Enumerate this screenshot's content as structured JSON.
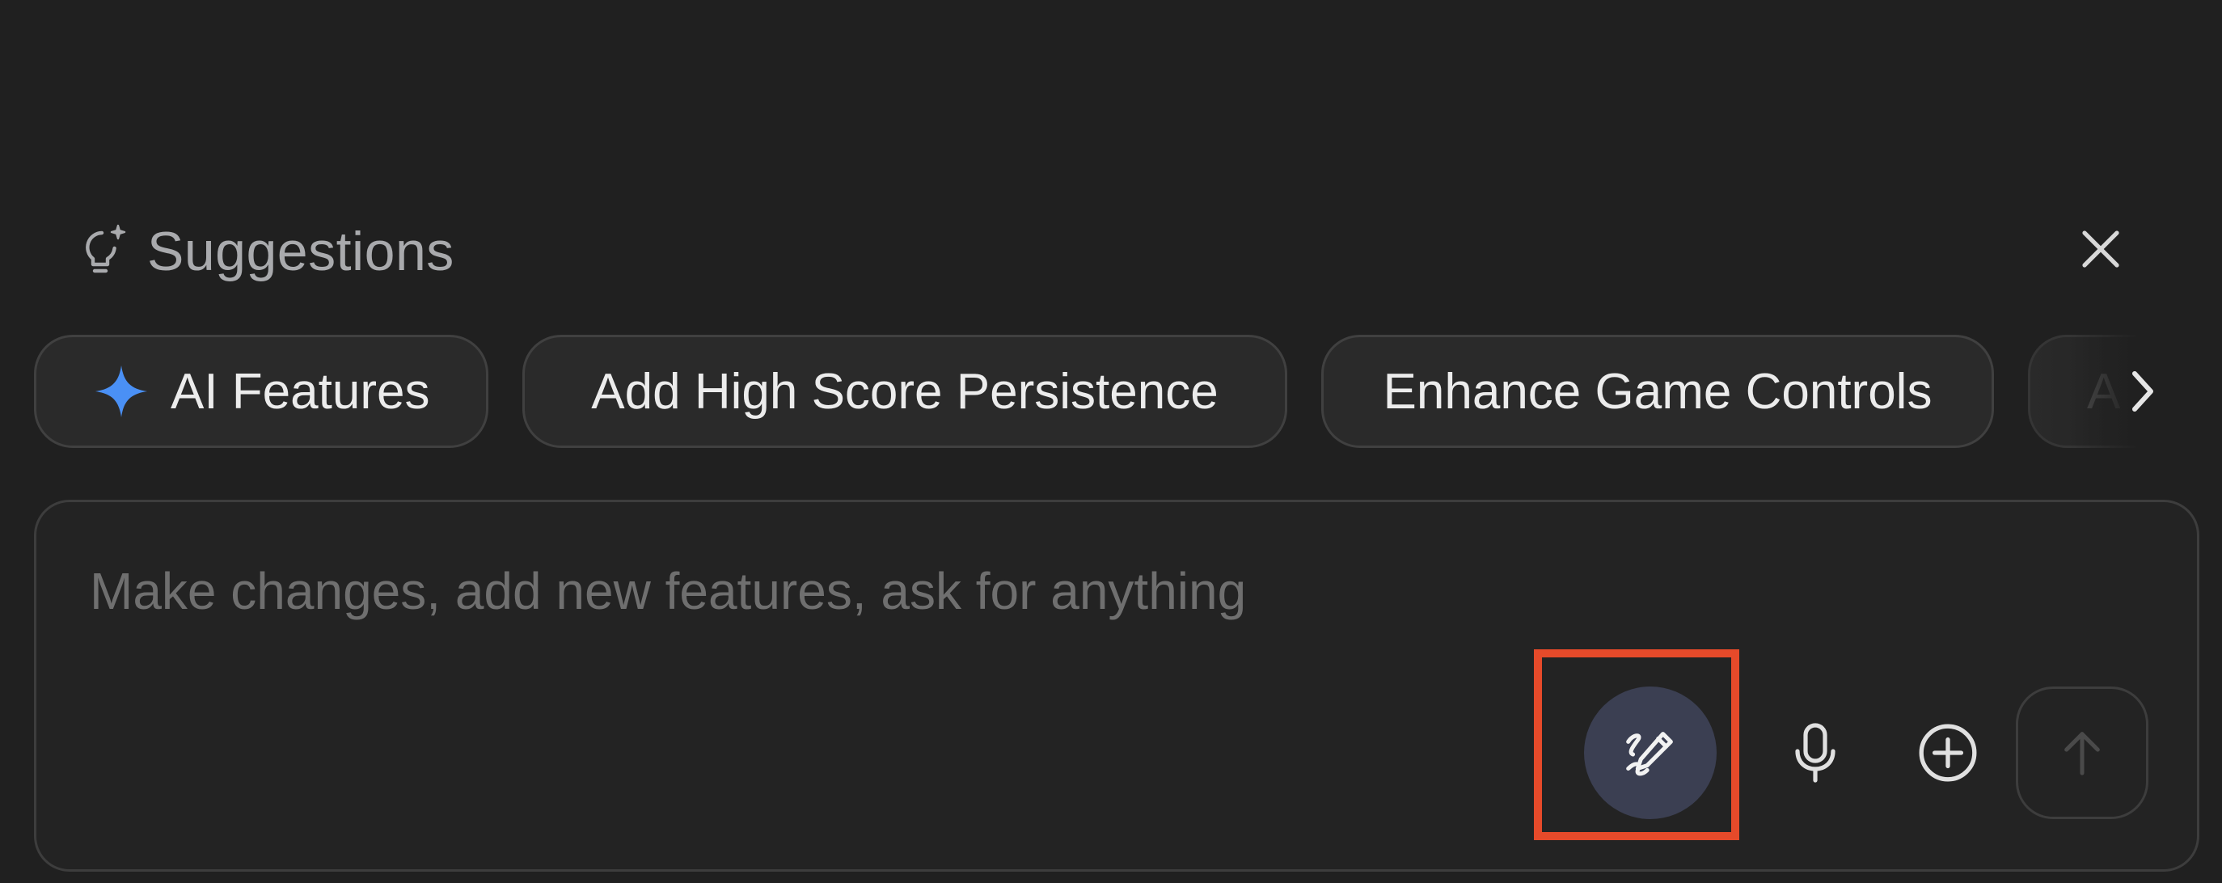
{
  "suggestions": {
    "title": "Suggestions",
    "icon": "lightbulb-sparkle-icon",
    "close_icon": "close-icon",
    "chips": [
      {
        "label": "AI Features",
        "icon": "sparkle-icon",
        "icon_color": "#4a90f5"
      },
      {
        "label": "Add High Score Persistence"
      },
      {
        "label": "Enhance Game Controls"
      },
      {
        "label": "A"
      }
    ],
    "scroll_icon": "chevron-right-icon"
  },
  "composer": {
    "placeholder": "Make changes, add new features, ask for anything",
    "value": "",
    "tools": [
      {
        "name": "draw",
        "icon": "pen-scribble-icon"
      },
      {
        "name": "voice",
        "icon": "microphone-icon"
      },
      {
        "name": "attach",
        "icon": "plus-circle-icon"
      },
      {
        "name": "send",
        "icon": "arrow-up-icon"
      }
    ]
  },
  "colors": {
    "background": "#202020",
    "chip_border": "#404040",
    "draw_button": "#3b3f52",
    "highlight": "#e64a2a",
    "accent_blue": "#4a90f5"
  }
}
